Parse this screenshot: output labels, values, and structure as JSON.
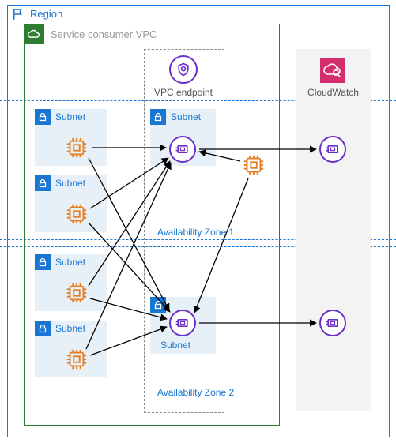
{
  "region": {
    "label": "Region"
  },
  "vpc": {
    "label": "Service consumer VPC"
  },
  "endpoint": {
    "label": "VPC endpoint"
  },
  "cloudwatch": {
    "label": "CloudWatch"
  },
  "az1": {
    "label": "Availability Zone 1"
  },
  "az2": {
    "label": "Availability Zone 2"
  },
  "subnet": {
    "s1": "Subnet",
    "s2": "Subnet",
    "s3": "Subnet",
    "s4": "Subnet",
    "s5": "Subnet",
    "s6": "Subnet"
  }
}
